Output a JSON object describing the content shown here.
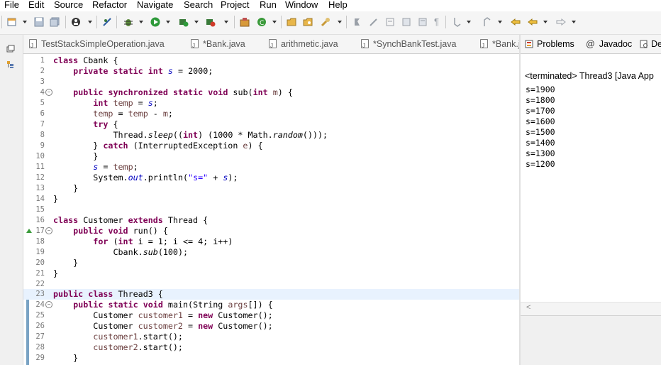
{
  "menu": [
    "File",
    "Edit",
    "Source",
    "Refactor",
    "Navigate",
    "Search",
    "Project",
    "Run",
    "Window",
    "Help"
  ],
  "editor_tabs": [
    "TestStackSimpleOperation.java",
    "*Bank.java",
    "arithmetic.java",
    "*SynchBankTest.java",
    "*Bank.j"
  ],
  "view_tabs": [
    "Problems",
    "@",
    "Javadoc",
    "De"
  ],
  "console": {
    "header": "<terminated> Thread3 [Java App",
    "lines": [
      "s=1900",
      "s=1800",
      "s=1700",
      "s=1600",
      "s=1500",
      "s=1400",
      "s=1300",
      "s=1200"
    ]
  },
  "line_numbers": [
    "1",
    "2",
    "3",
    "4",
    "5",
    "6",
    "7",
    "8",
    "9",
    "10",
    "11",
    "12",
    "13",
    "14",
    "15",
    "16",
    "17",
    "18",
    "19",
    "20",
    "21",
    "22",
    "23",
    "24",
    "25",
    "26",
    "27",
    "28",
    "29"
  ],
  "code": {
    "l1": [
      "class",
      " Cbank {"
    ],
    "l2": [
      "private",
      "static",
      "int",
      "s",
      " = 2000;"
    ],
    "l4": [
      "public",
      "synchronized",
      "static",
      "void",
      " sub(",
      "int",
      "m",
      ") {"
    ],
    "l5": [
      "int",
      "temp",
      " = ",
      "s",
      ";"
    ],
    "l6": [
      "temp",
      " = ",
      "temp",
      " - ",
      "m",
      ";"
    ],
    "l7": [
      "try",
      " {"
    ],
    "l8": [
      "Thread.",
      "sleep",
      "((",
      "int",
      ") (1000 * Math.",
      "random",
      "()));"
    ],
    "l9": [
      "} ",
      "catch",
      " (InterruptedException ",
      "e",
      ") {"
    ],
    "l10": [
      "}"
    ],
    "l11": [
      "s",
      " = ",
      "temp",
      ";"
    ],
    "l12": [
      "System.",
      "out",
      ".println(",
      "\"s=\"",
      " + ",
      "s",
      ");"
    ],
    "l13": [
      "}"
    ],
    "l14": [
      "}"
    ],
    "l16": [
      "class",
      " Customer ",
      "extends",
      " Thread {"
    ],
    "l17": [
      "public",
      "void",
      " run() {"
    ],
    "l18": [
      "for",
      " (",
      "int",
      " i = 1; i <= 4; i++)"
    ],
    "l19": [
      "Cbank.",
      "sub",
      "(100);"
    ],
    "l20": [
      "}"
    ],
    "l21": [
      "}"
    ],
    "l23": [
      "public",
      "class",
      " Thread3 {"
    ],
    "l24": [
      "public",
      "static",
      "void",
      " main(String ",
      "args",
      "[]) {"
    ],
    "l25": [
      "Customer ",
      "customer1",
      " = ",
      "new",
      " Customer();"
    ],
    "l26": [
      "Customer ",
      "customer2",
      " = ",
      "new",
      " Customer();"
    ],
    "l27": [
      "customer1",
      ".start();"
    ],
    "l28": [
      "customer2",
      ".start();"
    ],
    "l29": [
      "}"
    ]
  },
  "colors": {
    "keyword": "#7f0055",
    "field": "#0000c0",
    "string": "#2a00ff",
    "local": "#6a3e3e",
    "current_line": "#e8f2fe"
  }
}
